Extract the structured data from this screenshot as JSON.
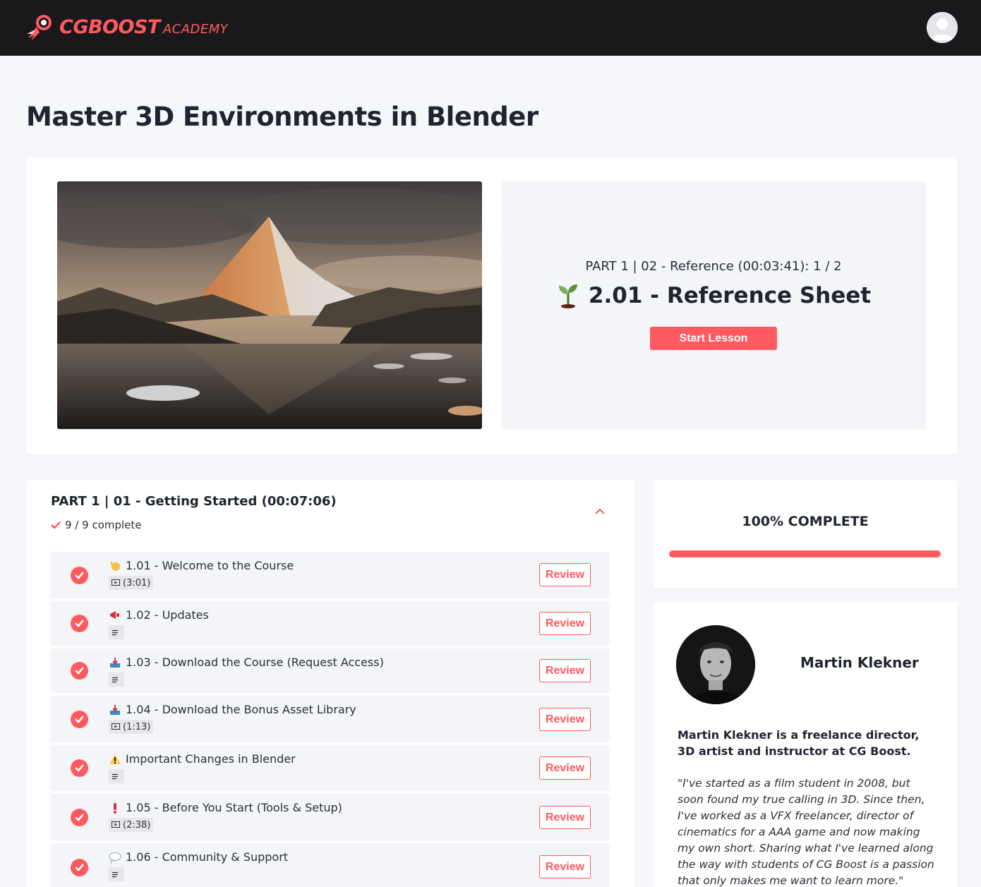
{
  "brand": {
    "name": "CGBOOST",
    "sub": "ACADEMY",
    "accent_color": "#ff5a5f",
    "logo_icon": "rocket-icon"
  },
  "header": {
    "avatar_icon": "user-avatar-icon"
  },
  "page": {
    "title": "Master 3D Environments in Blender"
  },
  "hero": {
    "image_icon": "mountain-lake-thumbnail",
    "next_lesson_context": "PART 1 | 02 - Reference (00:03:41): 1 / 2",
    "next_lesson_title": "2.01 - Reference Sheet",
    "next_lesson_icon": "seedling-icon",
    "start_label": "Start Lesson"
  },
  "section": {
    "title": "PART 1 | 01 - Getting Started (00:07:06)",
    "progress": "9 / 9 complete",
    "expanded": true,
    "lessons": [
      {
        "emoji": "waving-hand-icon",
        "title": "1.01 - Welcome to the Course",
        "type": "video",
        "duration": "(3:01)",
        "completed": true,
        "action": "Review"
      },
      {
        "emoji": "megaphone-icon",
        "title": "1.02 - Updates",
        "type": "text",
        "duration": "",
        "completed": true,
        "action": "Review"
      },
      {
        "emoji": "inbox-tray-icon",
        "title": "1.03 - Download the Course (Request Access)",
        "type": "text",
        "duration": "",
        "completed": true,
        "action": "Review"
      },
      {
        "emoji": "inbox-tray-icon",
        "title": "1.04 - Download the Bonus Asset Library",
        "type": "video",
        "duration": "(1:13)",
        "completed": true,
        "action": "Review"
      },
      {
        "emoji": "warning-icon",
        "title": "Important Changes in Blender",
        "type": "text",
        "duration": "",
        "completed": true,
        "action": "Review"
      },
      {
        "emoji": "exclamation-icon",
        "title": "1.05 - Before You Start (Tools & Setup)",
        "type": "video",
        "duration": "(2:38)",
        "completed": true,
        "action": "Review"
      },
      {
        "emoji": "speech-bubble-icon",
        "title": "1.06 - Community & Support",
        "type": "text",
        "duration": "",
        "completed": true,
        "action": "Review"
      }
    ]
  },
  "course_progress": {
    "label": "100% COMPLETE",
    "value": 1.0
  },
  "author": {
    "name": "Martin Klekner",
    "bio": "Martin Klekner is a freelance director, 3D artist and instructor at CG Boost.",
    "quote": "\"I've started as a film student in 2008, but soon found my true calling in 3D. Since then, I've worked as a VFX freelancer, director of cinematics for a AAA game and now making my own short. Sharing what I've learned along the way with students of CG Boost is a passion that only makes me want to learn more.\""
  }
}
